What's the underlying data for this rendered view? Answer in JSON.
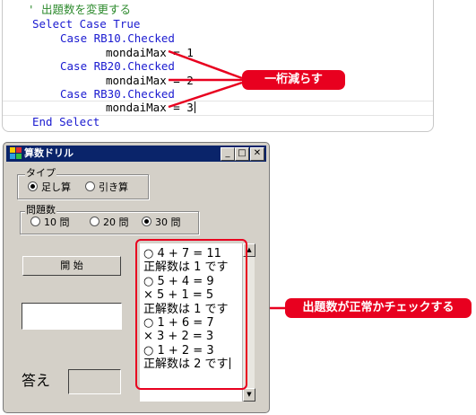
{
  "code": {
    "lines": [
      "' 出題数を変更する",
      "Select Case True",
      "Case RB10.Checked",
      "mondaiMax = 1",
      "Case RB20.Checked",
      "mondaiMax = 2",
      "Case RB30.Checked",
      "mondaiMax = 3",
      "End Select"
    ],
    "colors": {
      "keyword": "#1a1ad0",
      "comment": "#2e8b2e",
      "text": "#000000"
    }
  },
  "callouts": {
    "top": "一桁減らす",
    "side": "出題数が正常かチェックする",
    "color": "#e8001f"
  },
  "window": {
    "title": "算数ドリル",
    "title_bar_color": "#0a246a",
    "type_group": {
      "label": "タイプ",
      "options": [
        "足し算",
        "引き算"
      ],
      "selected": "足し算"
    },
    "count_group": {
      "label": "問題数",
      "options": [
        "10 問",
        "20 問",
        "30 問"
      ],
      "selected": "30 問"
    },
    "start_button": "開 始",
    "answer_label": "答え",
    "results": [
      "○ 4 + 7 = 11",
      "正解数は 1 です",
      "○ 5 + 4 = 9",
      "× 5 + 1 = 5",
      "正解数は 1 です",
      "○ 1 + 6 = 7",
      "× 3 + 2 = 3",
      "○ 1 + 2 = 3",
      "正解数は 2 です"
    ]
  }
}
